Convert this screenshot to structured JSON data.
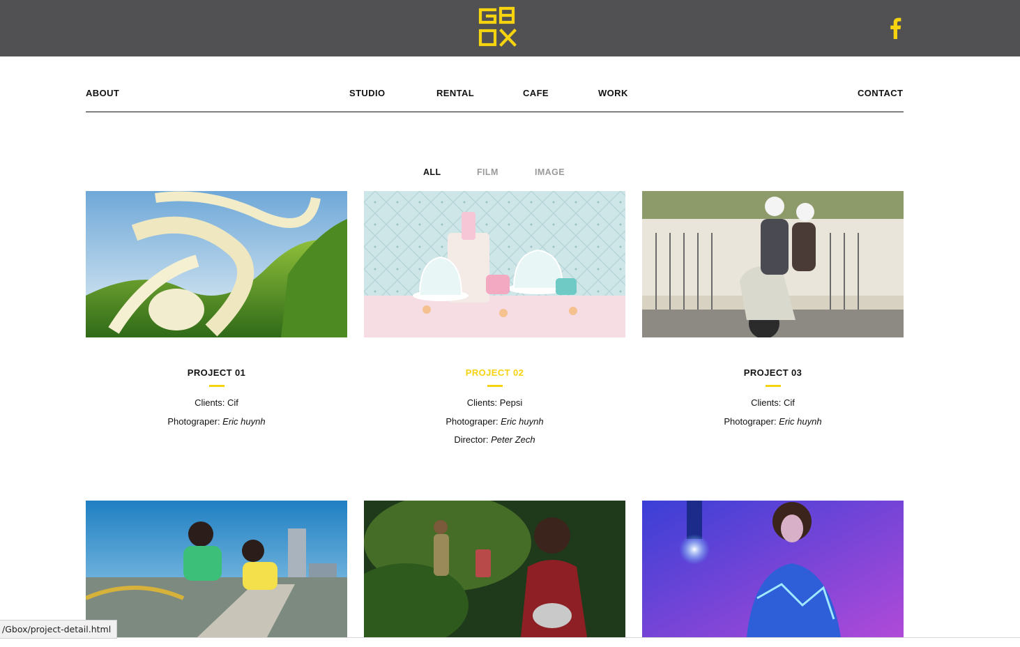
{
  "header": {
    "logo_text": "GBOX",
    "brand_color": "#f6d30f",
    "bar_color": "#515153",
    "social_icon": "facebook-icon"
  },
  "nav": {
    "about": "ABOUT",
    "studio": "STUDIO",
    "rental": "RENTAL",
    "cafe": "CAFE",
    "work": "WORK",
    "contact": "CONTACT"
  },
  "filters": [
    {
      "label": "ALL",
      "active": true
    },
    {
      "label": "FILM",
      "active": false
    },
    {
      "label": "IMAGE",
      "active": false
    }
  ],
  "projects": [
    {
      "title": "PROJECT 01",
      "clients_label": "Clients: ",
      "clients": "Cif",
      "photographer_label": "Photograper: ",
      "photographer": "Eric huynh",
      "image": "milk-splash-over-green-fields"
    },
    {
      "title": "PROJECT 02",
      "clients_label": "Clients: ",
      "clients": "Pepsi",
      "photographer_label": "Photograper: ",
      "photographer": "Eric huynh",
      "director_label": "Director: ",
      "director": "Peter Zech",
      "image": "pastel-cake-display"
    },
    {
      "title": "PROJECT 03",
      "clients_label": "Clients: ",
      "clients": "Cif",
      "photographer_label": "Photograper: ",
      "photographer": "Eric huynh",
      "image": "couple-on-scooter"
    },
    {
      "image": "city-cleaning-ad"
    },
    {
      "image": "jungle-fashion-scene"
    },
    {
      "image": "woman-blue-crystal-light"
    }
  ],
  "status_url": "/Gbox/project-detail.html"
}
